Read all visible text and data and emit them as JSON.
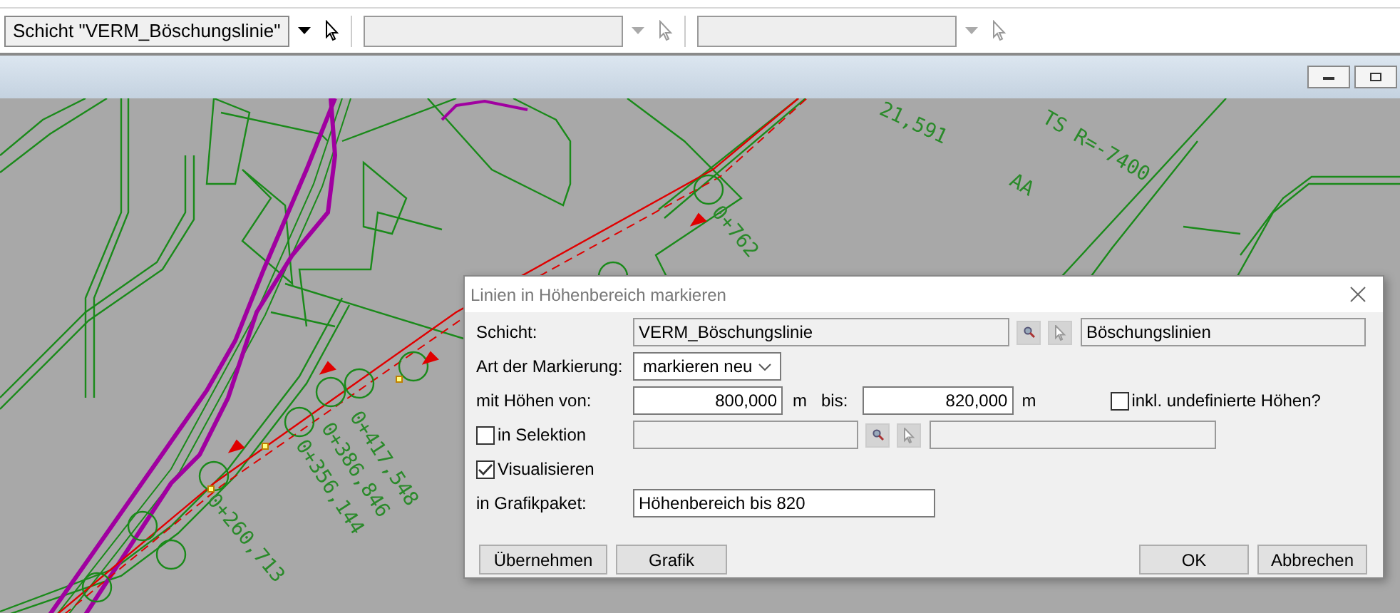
{
  "toolbar": {
    "combos": [
      {
        "value": "Schicht \"VERM_Böschungslinie\"",
        "disabled": false
      },
      {
        "disabled": true
      },
      {
        "disabled": true
      }
    ]
  },
  "map": {
    "labels": [
      "21,591",
      "TS R=-7400",
      "AA",
      "0+762",
      "0+417,548",
      "0+386,846",
      "0+356,144",
      "0+260,713"
    ]
  },
  "dialog": {
    "title": "Linien in Höhenbereich markieren",
    "layer": {
      "label": "Schicht:",
      "value": "VERM_Böschungslinie",
      "description": "Böschungslinien"
    },
    "marking": {
      "label": "Art der Markierung:",
      "value": "markieren neu"
    },
    "height": {
      "label": "mit Höhen von:",
      "from": "800,000",
      "from_unit": "m",
      "to_label": "bis:",
      "to": "820,000",
      "to_unit": "m",
      "undefined_option": {
        "label": "inkl. undefinierte Höhen?",
        "checked": false
      }
    },
    "selection": {
      "label": "in Selektion",
      "checked": false
    },
    "visualize": {
      "label": "Visualisieren",
      "checked": true
    },
    "package": {
      "label": "in Grafikpaket:",
      "value": "Höhenbereich bis 820"
    },
    "buttons": [
      {
        "label": "Übernehmen",
        "kind": "left"
      },
      {
        "label": "Grafik",
        "kind": "left"
      },
      {
        "label": "OK",
        "kind": "right"
      },
      {
        "label": "Abbrechen",
        "kind": "right"
      }
    ]
  }
}
